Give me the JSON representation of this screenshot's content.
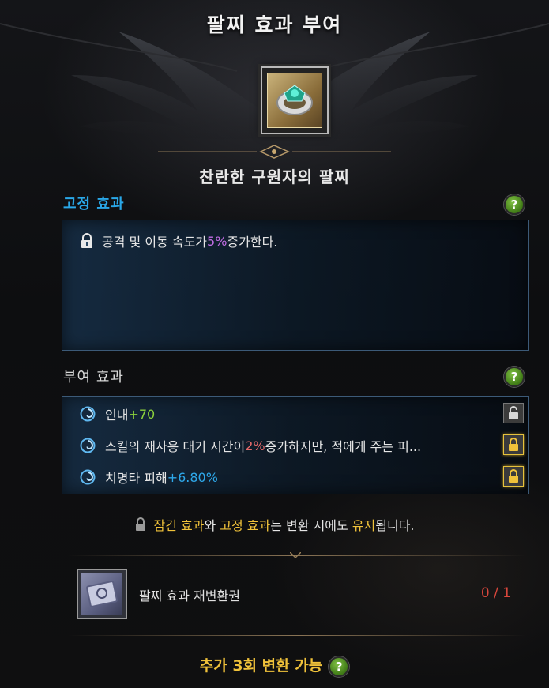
{
  "title": "팔찌 효과 부여",
  "item": {
    "name": "찬란한 구원자의 팔찌",
    "icon": "bracelet-icon"
  },
  "fixed_section": {
    "label": "고정 효과",
    "label_color": "#2aa8e8",
    "help": "?",
    "effects": [
      {
        "prefix": "공격 및 이동 속도가 ",
        "value": "5%",
        "suffix": " 증가한다.",
        "value_color": "#c46ee6",
        "icon": "lock-icon"
      }
    ]
  },
  "granted_section": {
    "label": "부여 효과",
    "label_color": "#d8d8d8",
    "help": "?",
    "effects": [
      {
        "prefix": "인내 ",
        "value": "+70",
        "suffix": "",
        "value_color": "#8cd23c",
        "icon": "swirl-icon",
        "locked": false
      },
      {
        "prefix": "스킬의 재사용 대기 시간이 ",
        "value": "2%",
        "suffix": " 증가하지만, 적에게 주는 피...",
        "value_color": "#e86a6a",
        "icon": "swirl-icon",
        "locked": true
      },
      {
        "prefix": "치명타 피해 ",
        "value": "+6.80%",
        "suffix": "",
        "value_color": "#2ea8ea",
        "icon": "swirl-icon",
        "locked": true
      }
    ]
  },
  "notice": {
    "part1": "잠긴 효과",
    "part2": "와 ",
    "part3": "고정 효과",
    "part4": "는 변환 시에도 ",
    "part5": "유지",
    "part6": "됩니다.",
    "highlight_color": "#f0c23a"
  },
  "ticket": {
    "name": "팔찌 효과 재변환권",
    "count": "0 / 1",
    "icon": "ticket-icon"
  },
  "footer": {
    "text": "추가 3회 변환 가능",
    "help": "?"
  }
}
